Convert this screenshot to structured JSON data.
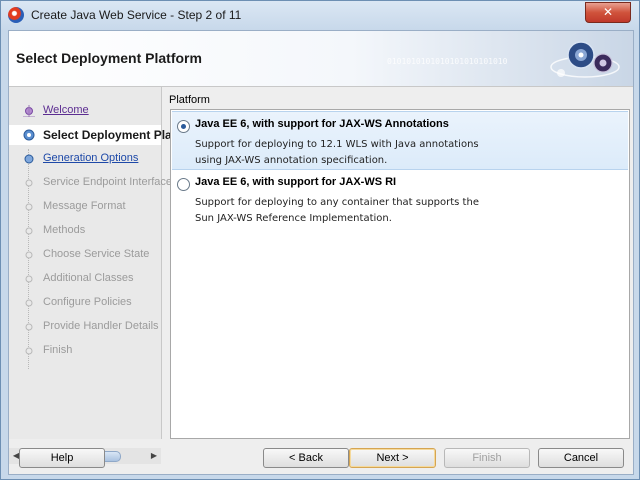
{
  "window": {
    "title": "Create Java Web Service - Step 2 of 11",
    "close_glyph": "✕"
  },
  "banner": {
    "title": "Select Deployment Platform",
    "binary_text": "0101010101010101010101010"
  },
  "steps": [
    {
      "label": "Welcome",
      "state": "visited"
    },
    {
      "label": "Select Deployment Platform",
      "state": "current"
    },
    {
      "label": "Generation Options",
      "state": "next"
    },
    {
      "label": "Service Endpoint Interface",
      "state": "future"
    },
    {
      "label": "Message Format",
      "state": "future"
    },
    {
      "label": "Methods",
      "state": "future"
    },
    {
      "label": "Choose Service State",
      "state": "future"
    },
    {
      "label": "Additional Classes",
      "state": "future"
    },
    {
      "label": "Configure Policies",
      "state": "future"
    },
    {
      "label": "Provide Handler Details",
      "state": "future"
    },
    {
      "label": "Finish",
      "state": "future"
    }
  ],
  "scroll": {
    "left_arrow": "◀",
    "right_arrow": "▶"
  },
  "platform": {
    "label": "Platform",
    "options": [
      {
        "title": "Java EE 6, with support for JAX-WS Annotations",
        "desc_line1": "Support for deploying to 12.1 WLS with Java annotations",
        "desc_line2": "using JAX-WS annotation specification.",
        "checked": true
      },
      {
        "title": "Java EE 6, with support for JAX-WS RI",
        "desc_line1": "Support for deploying to any container that supports the",
        "desc_line2": "Sun JAX-WS Reference Implementation.",
        "checked": false
      }
    ]
  },
  "buttons": {
    "help": "Help",
    "back": "< Back",
    "next": "Next >",
    "finish": "Finish",
    "cancel": "Cancel"
  },
  "colors": {
    "accent": "#2a5a9a",
    "visited_link": "#5c2d91",
    "next_link": "#1e49a8",
    "disabled_text": "#9b9b9b"
  }
}
